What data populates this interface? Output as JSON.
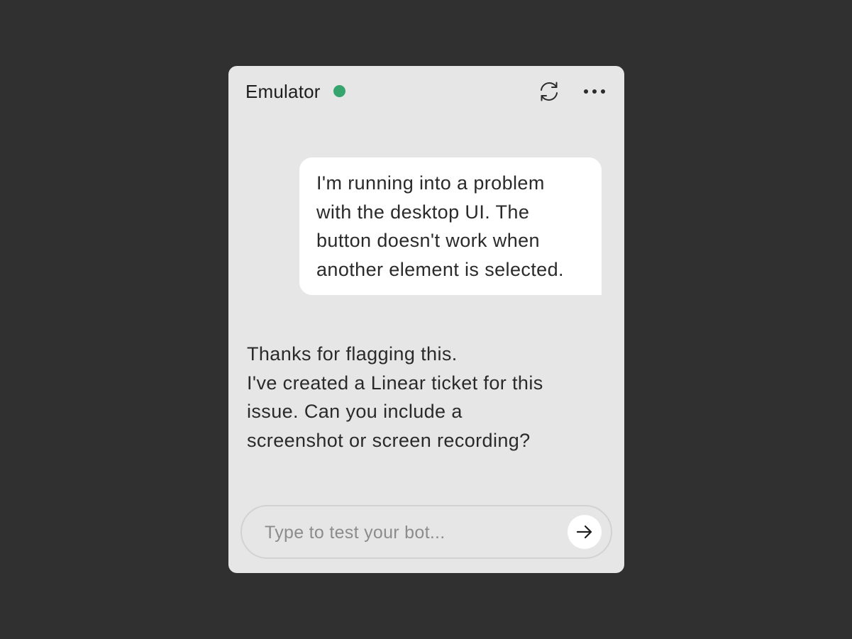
{
  "header": {
    "title": "Emulator",
    "status": "online",
    "status_color": "#35a56d",
    "refresh_icon": "refresh-icon",
    "more_icon": "more-horizontal-icon"
  },
  "messages": [
    {
      "role": "user",
      "text": "I'm running into a problem\nwith the desktop UI. The\nbutton doesn't work when\nanother element is selected."
    },
    {
      "role": "bot",
      "text": "Thanks for flagging this.\nI've created a Linear ticket for this\nissue. Can you include a\nscreenshot or screen recording?"
    }
  ],
  "composer": {
    "value": "",
    "placeholder": "Type to test your bot...",
    "send_icon": "arrow-right-icon"
  },
  "colors": {
    "background": "#303030",
    "panel": "#e6e6e6",
    "bubble": "#ffffff",
    "text": "#2a2a2a"
  }
}
